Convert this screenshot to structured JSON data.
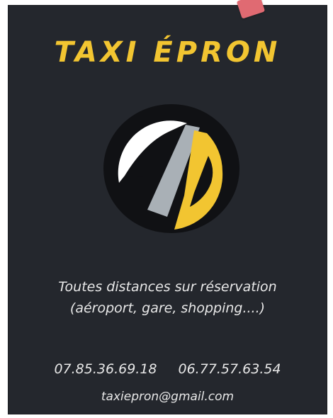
{
  "flyer": {
    "title": "TAXI ÉPRON",
    "tagline_line1": "Toutes distances sur réservation",
    "tagline_line2": "(aéroport, gare, shopping....)",
    "phone1": "07.85.36.69.18",
    "phone2": "06.77.57.63.54",
    "email": "taxiepron@gmail.com",
    "logo_icon": "road-logo-icon"
  },
  "colors": {
    "background": "#24272d",
    "accent": "#f2c531",
    "text": "#e8e8e8",
    "logo_white": "#ffffff",
    "logo_gray": "#a9b0b6",
    "logo_yellow": "#f2c531",
    "logo_black": "#101114"
  }
}
